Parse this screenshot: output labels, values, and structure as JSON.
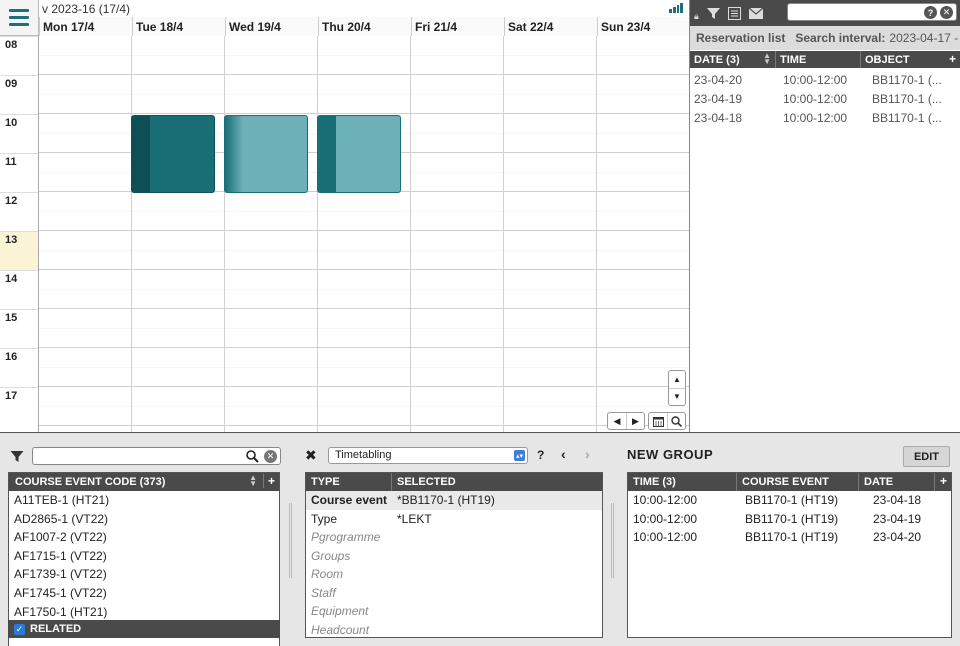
{
  "calendar": {
    "week_title": "v 2023-16 (17/4)",
    "days": [
      "Mon 17/4",
      "Tue 18/4",
      "Wed 19/4",
      "Thu 20/4",
      "Fri 21/4",
      "Sat 22/4",
      "Sun 23/4"
    ],
    "hours": [
      "08",
      "09",
      "10",
      "11",
      "12",
      "13",
      "14",
      "15",
      "16",
      "17"
    ],
    "current_hour": "13",
    "events": [
      {
        "day_index": 1,
        "start": "10:00",
        "end": "12:00",
        "style": "dark"
      },
      {
        "day_index": 2,
        "start": "10:00",
        "end": "12:00",
        "style": "light-fade"
      },
      {
        "day_index": 3,
        "start": "10:00",
        "end": "12:00",
        "style": "light"
      }
    ]
  },
  "reservations": {
    "title": "Reservation list",
    "interval_label": "Search interval:",
    "interval_value": "2023-04-17 -",
    "columns": [
      "DATE (3)",
      "TIME",
      "OBJECT"
    ],
    "rows": [
      {
        "date": "23-04-20",
        "time": "10:00-12:00",
        "object": "BB1170-1 (..."
      },
      {
        "date": "23-04-19",
        "time": "10:00-12:00",
        "object": "BB1170-1 (..."
      },
      {
        "date": "23-04-18",
        "time": "10:00-12:00",
        "object": "BB1170-1 (..."
      }
    ],
    "search_placeholder": ""
  },
  "course_list": {
    "search_placeholder": "",
    "header": "COURSE EVENT CODE (373)",
    "items": [
      "A11TEB-1 (HT21)",
      "AD2865-1 (VT22)",
      "AF1007-2 (VT22)",
      "AF1715-1 (VT22)",
      "AF1739-1 (VT22)",
      "AF1745-1 (VT22)",
      "AF1750-1 (HT21)"
    ],
    "related_label": "RELATED",
    "related_checked": true
  },
  "selection": {
    "mode": "Timetabling",
    "help": "?",
    "columns": [
      "TYPE",
      "SELECTED"
    ],
    "rows": [
      {
        "type": "Course event",
        "selected": "*BB1170-1 (HT19)",
        "state": "active"
      },
      {
        "type": "Type",
        "selected": "*LEKT",
        "state": "normal"
      },
      {
        "type": "Pgrogramme",
        "selected": "",
        "state": "disabled"
      },
      {
        "type": "Groups",
        "selected": "",
        "state": "disabled"
      },
      {
        "type": "Room",
        "selected": "",
        "state": "disabled"
      },
      {
        "type": "Staff",
        "selected": "",
        "state": "disabled"
      },
      {
        "type": "Equipment",
        "selected": "",
        "state": "disabled"
      },
      {
        "type": "Headcount",
        "selected": "",
        "state": "disabled"
      }
    ]
  },
  "group": {
    "title": "NEW GROUP",
    "edit_label": "EDIT",
    "columns": [
      "TIME (3)",
      "COURSE EVENT",
      "DATE"
    ],
    "rows": [
      {
        "time": "10:00-12:00",
        "course": "BB1170-1 (HT19)",
        "date": "23-04-18"
      },
      {
        "time": "10:00-12:00",
        "course": "BB1170-1 (HT19)",
        "date": "23-04-19"
      },
      {
        "time": "10:00-12:00",
        "course": "BB1170-1 (HT19)",
        "date": "23-04-20"
      }
    ]
  },
  "icons": {
    "menu": "hamburger-menu-icon",
    "stats": "bar-chart-icon",
    "filter": "filter-icon",
    "search": "search-icon",
    "clear": "clear-icon",
    "close": "close-icon"
  },
  "colors": {
    "accent": "#1f6f78",
    "event_dark": "#1a6e75",
    "event_light": "#6cb0b8",
    "header_dark": "#4a4a4a"
  }
}
